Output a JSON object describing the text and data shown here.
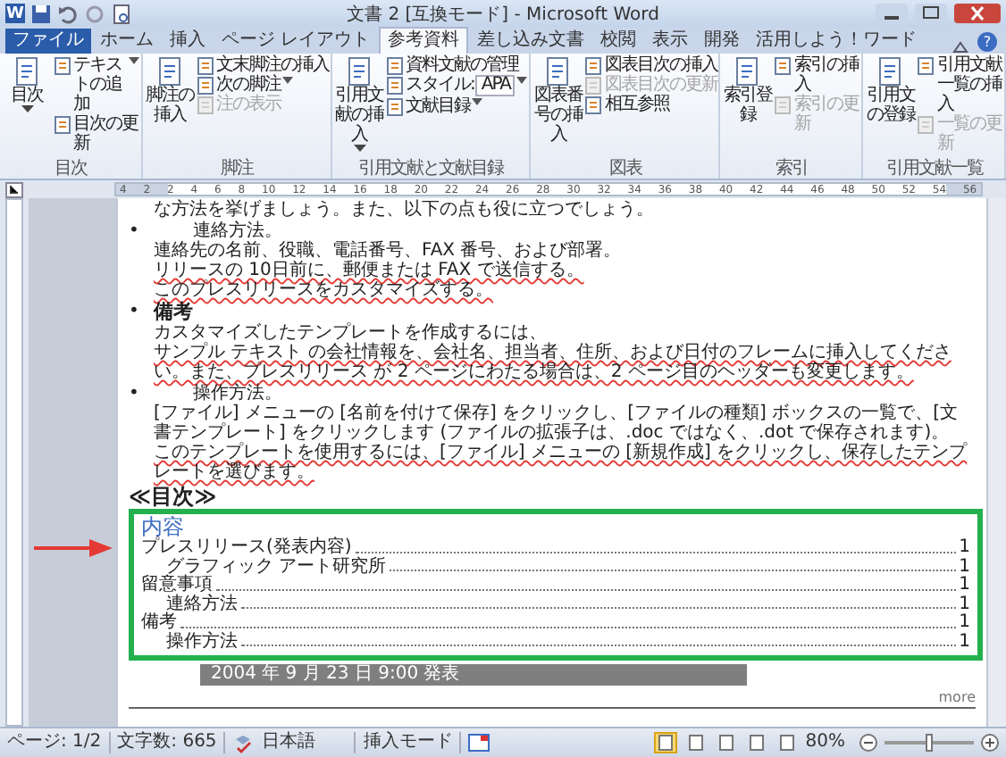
{
  "window": {
    "title": "文書 2 [互換モード] - Microsoft Word",
    "app_letter": "W"
  },
  "tabs": [
    {
      "label": "ファイル",
      "kind": "file",
      "selected": false
    },
    {
      "label": "ホーム",
      "kind": "tab",
      "selected": false
    },
    {
      "label": "挿入",
      "kind": "tab",
      "selected": false
    },
    {
      "label": "ページ レイアウト",
      "kind": "tab",
      "selected": false
    },
    {
      "label": "参考資料",
      "kind": "tab",
      "selected": true
    },
    {
      "label": "差し込み文書",
      "kind": "tab",
      "selected": false
    },
    {
      "label": "校閲",
      "kind": "tab",
      "selected": false
    },
    {
      "label": "表示",
      "kind": "tab",
      "selected": false
    },
    {
      "label": "開発",
      "kind": "tab",
      "selected": false
    },
    {
      "label": "活用しよう！ワード",
      "kind": "tab",
      "selected": false
    }
  ],
  "help": "?",
  "ribbon": {
    "groups": [
      {
        "label": "目次",
        "large": {
          "label": "目次",
          "caret": true
        },
        "small": [
          {
            "label": "テキストの追加",
            "kind": "button",
            "caret": true,
            "disabled": false
          },
          {
            "label": "目次の更新",
            "kind": "button",
            "caret": false,
            "disabled": false
          }
        ]
      },
      {
        "label": "脚注",
        "large": {
          "label": "脚注の挿入",
          "caret": false
        },
        "small": [
          {
            "label": "文末脚注の挿入",
            "kind": "button",
            "caret": false,
            "disabled": false
          },
          {
            "label": "次の脚注",
            "kind": "button",
            "caret": true,
            "disabled": false
          },
          {
            "label": "注の表示",
            "kind": "button",
            "caret": false,
            "disabled": true
          }
        ]
      },
      {
        "label": "引用文献と文献目録",
        "large": {
          "label": "引用文献の挿入",
          "caret": true
        },
        "small": [
          {
            "label": "資料文献の管理",
            "kind": "button",
            "caret": false,
            "disabled": false
          },
          {
            "label": "スタイル:",
            "kind": "dropdown",
            "value": "APA",
            "caret": true,
            "disabled": false
          },
          {
            "label": "文献目録",
            "kind": "button",
            "caret": true,
            "disabled": false
          }
        ]
      },
      {
        "label": "図表",
        "large": {
          "label": "図表番号の挿入",
          "caret": false
        },
        "small": [
          {
            "label": "図表目次の挿入",
            "kind": "button",
            "caret": false,
            "disabled": false
          },
          {
            "label": "図表目次の更新",
            "kind": "button",
            "caret": false,
            "disabled": true
          },
          {
            "label": "相互参照",
            "kind": "button",
            "caret": false,
            "disabled": false
          }
        ]
      },
      {
        "label": "索引",
        "large": {
          "label": "索引登録",
          "caret": false
        },
        "small": [
          {
            "label": "索引の挿入",
            "kind": "button",
            "caret": false,
            "disabled": false
          },
          {
            "label": "索引の更新",
            "kind": "button",
            "caret": false,
            "disabled": true
          }
        ]
      },
      {
        "label": "引用文献一覧",
        "large": {
          "label": "引用文の登録",
          "caret": false
        },
        "small": [
          {
            "label": "引用文献一覧の挿入",
            "kind": "button",
            "caret": false,
            "disabled": false
          },
          {
            "label": "一覧の更新",
            "kind": "button",
            "caret": false,
            "disabled": true
          }
        ]
      }
    ]
  },
  "ruler": {
    "labels": [
      "4",
      "2",
      "2",
      "4",
      "6",
      "8",
      "10",
      "12",
      "14",
      "16",
      "18",
      "20",
      "22",
      "24",
      "26",
      "28",
      "30",
      "32",
      "34",
      "36",
      "38",
      "40",
      "42",
      "44",
      "46",
      "48",
      "50",
      "52",
      "54",
      "56"
    ]
  },
  "document": {
    "lead": "な方法を挙げましょう。また、以下の点も役に立つでしょう。",
    "sections": [
      {
        "marker": "•",
        "heading": "連絡方法。",
        "kind": "label",
        "paragraphs": [
          {
            "text": "連絡先の名前、役職、電話番号、FAX 番号、および部署。",
            "underlined": false
          },
          {
            "text": "リリースの 10日前に、郵便または FAX で送信する。",
            "underlined": true
          },
          {
            "text": "このプレスリリースをカスタマイズする。",
            "underlined": true
          }
        ]
      },
      {
        "marker": "•",
        "heading": "備考",
        "kind": "title",
        "paragraphs": [
          {
            "text": "カスタマイズしたテンプレートを作成するには、",
            "underlined": false
          },
          {
            "text": "サンプル テキスト の会社情報を、会社名、担当者、住所、および日付のフレームに挿入してください。また、プレスリリース が 2 ページにわたる場合は、2 ページ目のヘッダーも変更します。",
            "underlined": true
          }
        ]
      },
      {
        "marker": "•",
        "heading": "操作方法。",
        "kind": "label",
        "paragraphs": [
          {
            "text": "[ファイル] メニューの [名前を付けて保存] をクリックし、[ファイルの種類] ボックスの一覧で、[文書テンプレート] をクリックします (ファイルの拡張子は、.doc ではなく、.dot で保存されます)。",
            "underlined": false
          },
          {
            "text": "このテンプレートを使用するには、[ファイル] メニューの [新規作成] をクリックし、保存したテンプレートを選びます。",
            "underlined": true
          }
        ]
      }
    ],
    "toc_heading": "≪目次≫",
    "toc": {
      "title": "内容",
      "entries": [
        {
          "text": "プレスリリース(発表内容)",
          "page": "1",
          "children": [
            {
              "text": "グラフィック アート研究所",
              "page": "1"
            }
          ]
        },
        {
          "text": "留意事項",
          "page": "1",
          "children": [
            {
              "text": "連絡方法",
              "page": "1"
            }
          ]
        },
        {
          "text": "備考",
          "page": "1",
          "children": [
            {
              "text": "操作方法",
              "page": "1"
            }
          ]
        }
      ]
    },
    "date_bar": "2004 年 9 月 23 日 9:00 発表",
    "footer": "more"
  },
  "status_bar": {
    "page": "ページ: 1/2",
    "words": "文字数: 665",
    "language": "日本語",
    "mode": "挿入モード",
    "views": [
      {
        "selected": true
      },
      {
        "selected": false
      },
      {
        "selected": false
      },
      {
        "selected": false
      },
      {
        "selected": false
      }
    ],
    "zoom": "80%",
    "zoom_slider": {
      "level": 0.5
    }
  }
}
